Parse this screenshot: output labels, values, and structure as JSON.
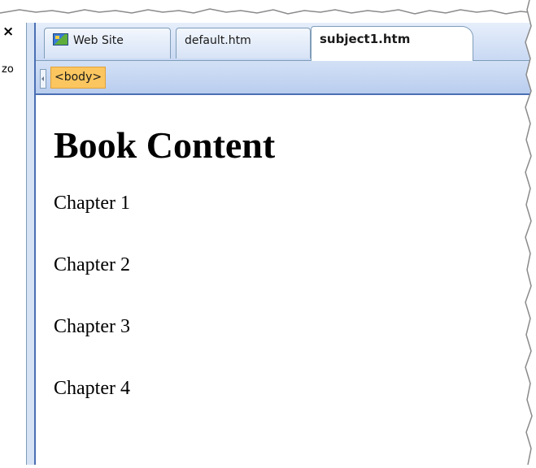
{
  "left_pane": {
    "close_glyph": "×",
    "cut_text": "zo"
  },
  "tabs": [
    {
      "label": "Web Site",
      "icon": "web-site-icon"
    },
    {
      "label": "default.htm"
    },
    {
      "label": "subject1.htm",
      "active": true
    }
  ],
  "tag_selector": {
    "tag": "<body>"
  },
  "document": {
    "heading": "Book Content",
    "paragraphs": [
      "Chapter 1",
      "Chapter 2",
      "Chapter 3",
      "Chapter 4"
    ]
  },
  "colors": {
    "tab_strip": "#c9d9f3",
    "tag_chip": "#fbc65f",
    "accent_border": "#4a6fb3"
  }
}
